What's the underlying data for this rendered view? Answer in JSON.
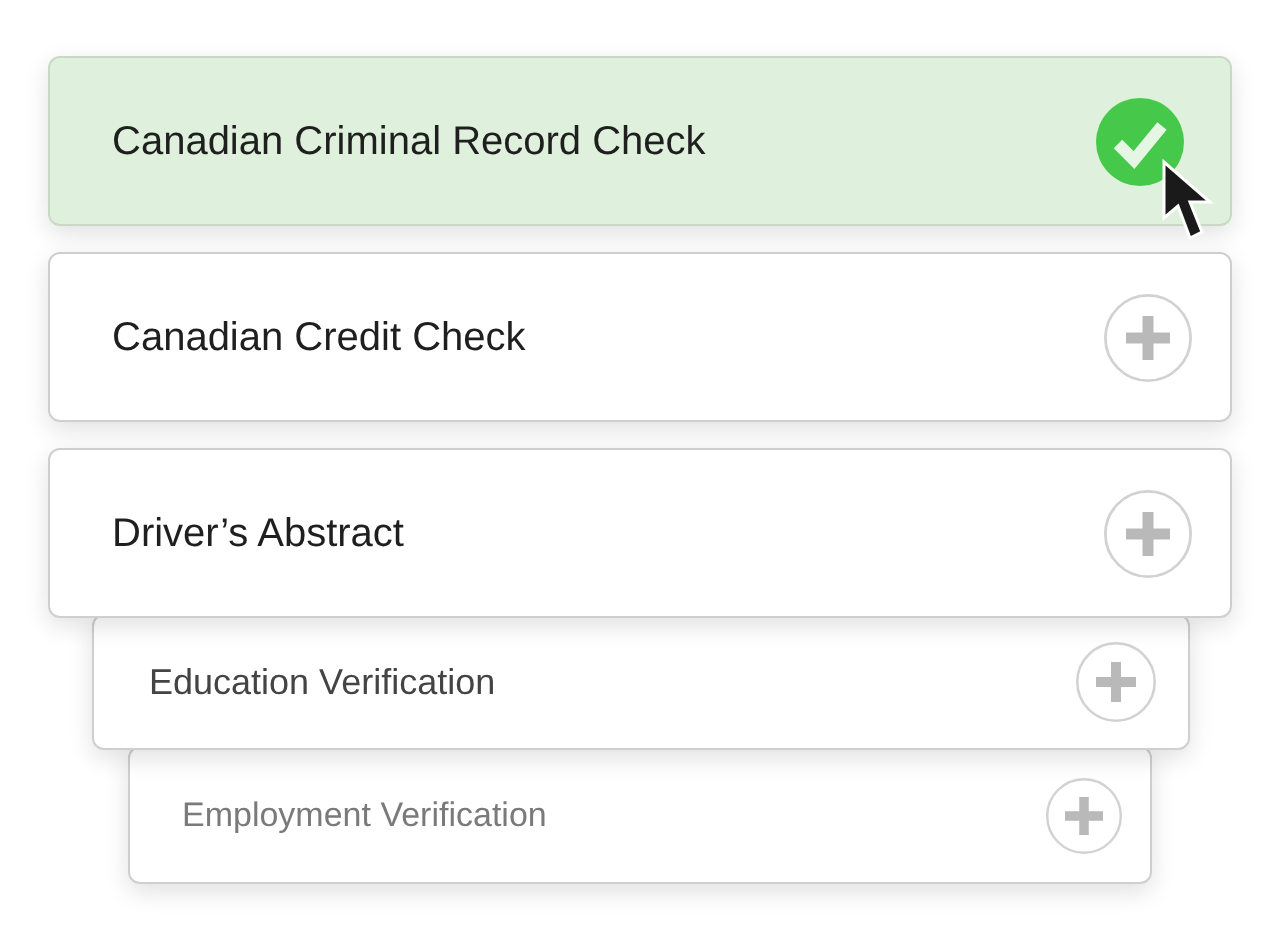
{
  "cards": [
    {
      "label": "Canadian Criminal Record Check",
      "selected": true
    },
    {
      "label": "Canadian Credit Check",
      "selected": false
    },
    {
      "label": "Driver’s Abstract",
      "selected": false
    },
    {
      "label": "Education Verification",
      "selected": false
    },
    {
      "label": "Employment Verification",
      "selected": false
    }
  ]
}
